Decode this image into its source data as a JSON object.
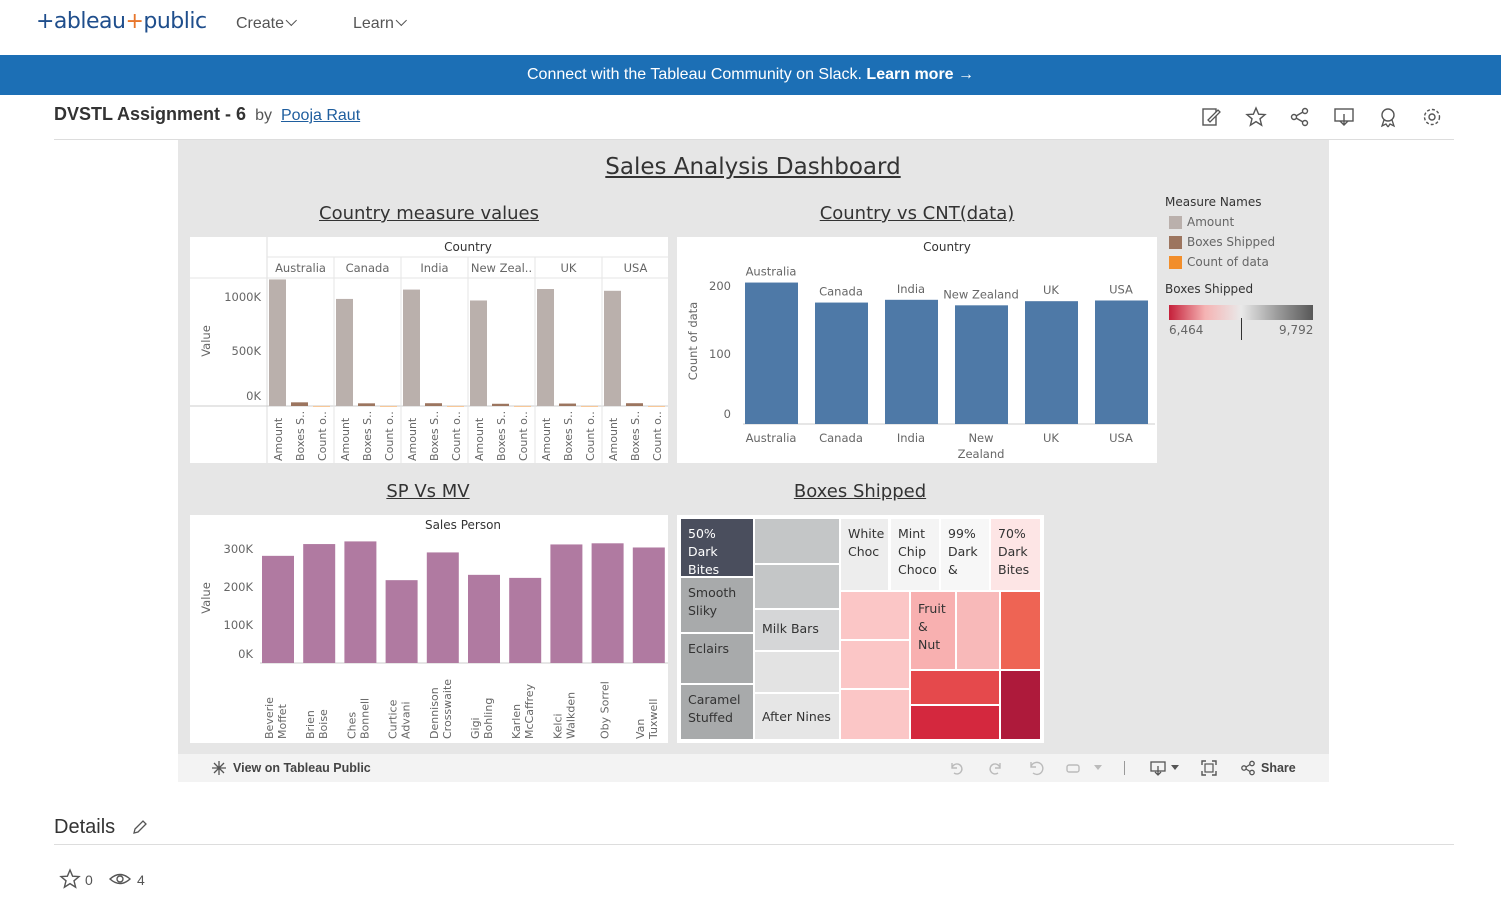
{
  "nav": {
    "logo_main": "+ableau",
    "logo_plus": "+",
    "logo_tail": "public",
    "create": "Create",
    "learn": "Learn"
  },
  "banner": {
    "text": "Connect with the Tableau Community on Slack. ",
    "link": "Learn more →"
  },
  "title": {
    "name": "DVSTL Assignment - 6",
    "by": "by",
    "author": "Pooja Raut"
  },
  "toolbar_icons": [
    "edit-icon",
    "star-icon",
    "share-icon",
    "download-icon",
    "badge-icon",
    "gear-icon"
  ],
  "dashboard": {
    "title": "Sales Analysis Dashboard",
    "s1": "Country measure values",
    "s2": "Country vs CNT(data)",
    "s3": "SP Vs MV",
    "s4": "Boxes Shipped",
    "legend_title": "Measure Names",
    "legend": [
      "Amount",
      "Boxes Shipped",
      "Count of data"
    ],
    "legend_colors": [
      "#bab0ac",
      "#9c755f",
      "#f28e2b"
    ],
    "grad_title": "Boxes Shipped",
    "grad_min": "6,464",
    "grad_max": "9,792"
  },
  "chart_data": [
    {
      "type": "bar",
      "title": "Country measure values",
      "header": "Country",
      "categories": [
        "Australia",
        "Canada",
        "India",
        "New Zeal..",
        "UK",
        "USA"
      ],
      "measures": [
        "Amount",
        "Boxes S..",
        "Count o.."
      ],
      "ylabel": "Value",
      "yticks": [
        "1000K",
        "500K",
        "0K"
      ],
      "ylim": [
        0,
        1150000
      ],
      "series": [
        {
          "name": "Amount",
          "values": [
            1137000,
            962000,
            1046000,
            948000,
            1051000,
            1035000
          ]
        },
        {
          "name": "Boxes Shipped",
          "values": [
            33000,
            24000,
            25000,
            20000,
            22000,
            25000
          ]
        },
        {
          "name": "Count of data",
          "values": [
            205,
            176,
            180,
            172,
            178,
            179
          ]
        }
      ]
    },
    {
      "type": "bar",
      "title": "Country vs CNT(data)",
      "header": "Country",
      "categories": [
        "Australia",
        "Canada",
        "India",
        "New Zealand",
        "UK",
        "USA"
      ],
      "xlabels": [
        "Australia",
        "Canada",
        "India",
        "New Zealand",
        "UK",
        "USA"
      ],
      "ylabel": "Count of data",
      "yticks": [
        "200",
        "100",
        "0"
      ],
      "ylim": [
        0,
        200
      ],
      "values": [
        205,
        176,
        180,
        172,
        178,
        179
      ]
    },
    {
      "type": "bar",
      "title": "SP Vs MV",
      "header": "Sales Person",
      "categories": [
        "Beverie Moffet",
        "Brien Boise",
        "Ches Bonnell",
        "Curtice Advani",
        "Dennison Crosswaite",
        "Gigi Bohling",
        "Karlen McCaffrey",
        "Kelci Walkden",
        "Oby Sorrel",
        "Van Tuxwell"
      ],
      "ylabel": "Value",
      "yticks": [
        "300K",
        "200K",
        "100K",
        "0K"
      ],
      "ylim": [
        0,
        300000
      ],
      "values": [
        282000,
        313000,
        320000,
        218000,
        291000,
        232000,
        224000,
        312000,
        315000,
        304000
      ]
    },
    {
      "type": "heatmap",
      "title": "Boxes Shipped",
      "cells": [
        "50% Dark Bites",
        "Smooth Sliky",
        "Eclairs",
        "Caramel Stuffed",
        "Milk Bars",
        "After Nines",
        "White Choc",
        "Mint Chip Choco",
        "99% Dark &",
        "70% Dark Bites",
        "Fruit & Nut"
      ]
    }
  ],
  "vizbar": {
    "view": "View on Tableau Public",
    "share": "Share"
  },
  "details": {
    "title": "Details",
    "stars": "0",
    "views": "4"
  }
}
